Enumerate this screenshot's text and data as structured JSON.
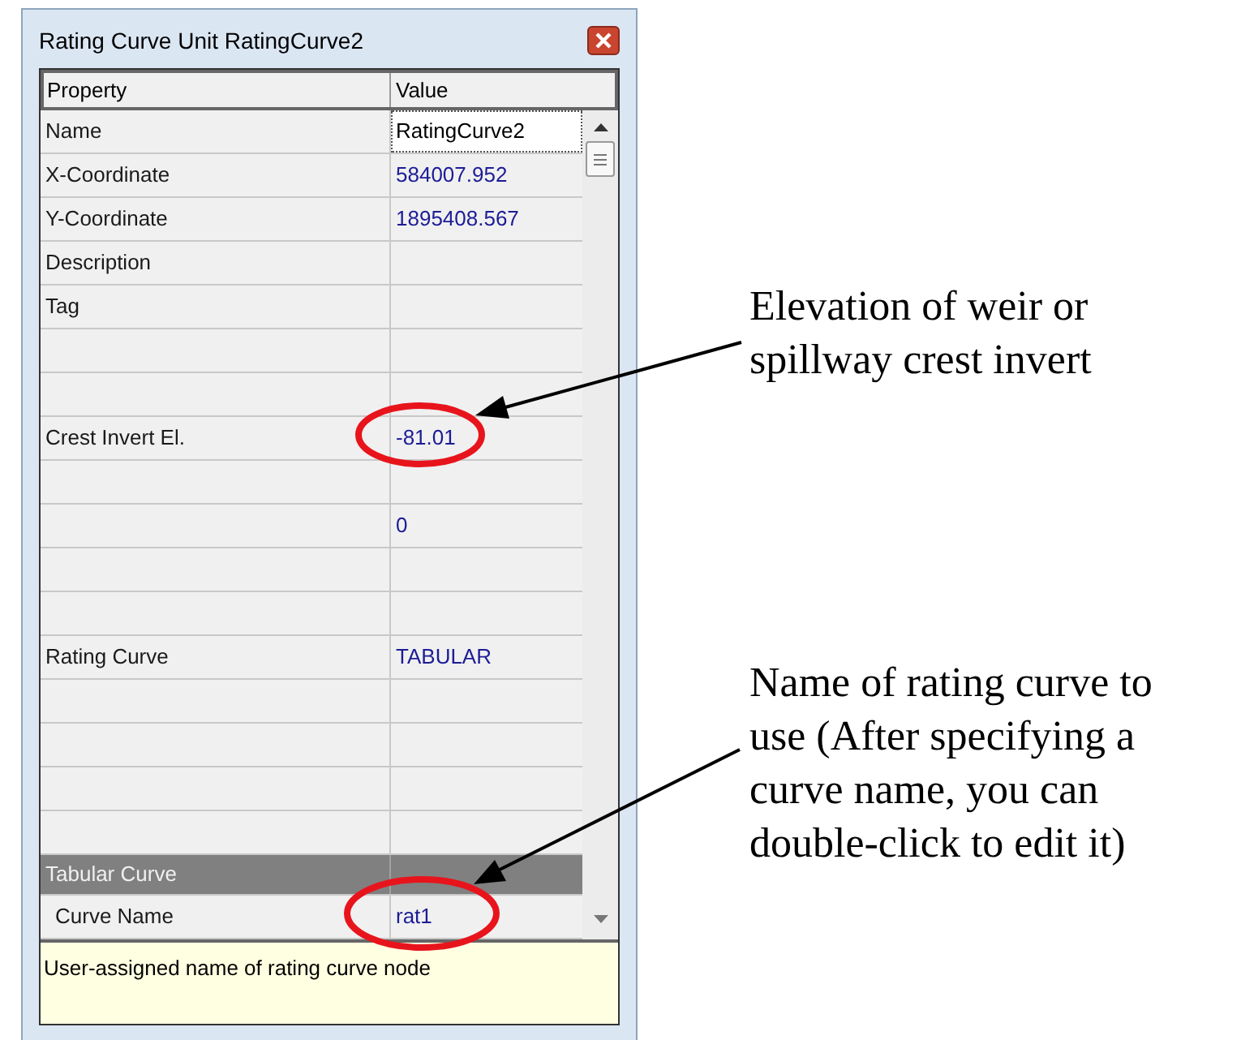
{
  "window": {
    "title": "Rating Curve Unit RatingCurve2"
  },
  "grid": {
    "columns": [
      "Property",
      "Value"
    ],
    "rows": [
      {
        "kind": "row",
        "property": "Name",
        "value": "RatingCurve2",
        "selected": true
      },
      {
        "kind": "row",
        "property": "X-Coordinate",
        "value": "584007.952",
        "selected": false
      },
      {
        "kind": "row",
        "property": "Y-Coordinate",
        "value": "1895408.567",
        "selected": false
      },
      {
        "kind": "row",
        "property": "Description",
        "selected": false
      },
      {
        "kind": "row",
        "property": "Tag",
        "selected": false
      },
      {
        "kind": "row",
        "selected": false
      },
      {
        "kind": "row",
        "selected": false
      },
      {
        "kind": "row",
        "property": "Crest Invert El.",
        "value": "-81.01",
        "selected": false
      },
      {
        "kind": "row",
        "selected": false
      },
      {
        "kind": "row",
        "value": "0",
        "selected": false
      },
      {
        "kind": "row",
        "selected": false
      },
      {
        "kind": "row",
        "selected": false
      },
      {
        "kind": "row",
        "property": "Rating Curve",
        "value": "TABULAR",
        "selected": false
      },
      {
        "kind": "row",
        "selected": false
      },
      {
        "kind": "row",
        "selected": false
      },
      {
        "kind": "row",
        "selected": false
      },
      {
        "kind": "row",
        "selected": false
      },
      {
        "kind": "category",
        "property": "Tabular Curve"
      },
      {
        "kind": "subrow",
        "property": "Curve Name",
        "value": "rat1",
        "selected": false
      }
    ]
  },
  "description": "User-assigned name of rating curve node",
  "annotations": [
    {
      "lines": [
        "Elevation of weir or",
        "spillway crest invert"
      ]
    },
    {
      "lines": [
        "Name of rating curve to",
        "use (After specifying a",
        "curve name, you can",
        "double-click to edit it)"
      ]
    }
  ]
}
